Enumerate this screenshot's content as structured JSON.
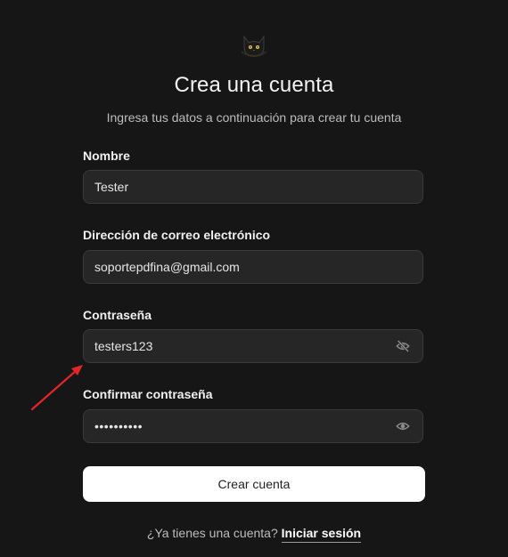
{
  "header": {
    "logo_icon": "cat-logo-icon",
    "title": "Crea una cuenta",
    "subtitle": "Ingresa tus datos a continuación para crear tu cuenta"
  },
  "form": {
    "name": {
      "label": "Nombre",
      "value": "Tester"
    },
    "email": {
      "label": "Dirección de correo electrónico",
      "value": "soportepdfina@gmail.com"
    },
    "password": {
      "label": "Contraseña",
      "value": "testers123",
      "toggle_icon": "eye-off-icon"
    },
    "confirm_password": {
      "label": "Confirmar contraseña",
      "value": "••••••••••",
      "toggle_icon": "eye-icon"
    },
    "submit_label": "Crear cuenta"
  },
  "footer": {
    "prompt": "¿Ya tienes una cuenta?",
    "link": "Iniciar sesión"
  },
  "annotation": {
    "arrow_color": "#e0262b"
  },
  "colors": {
    "background": "#161616",
    "field_bg": "#262626",
    "button_bg": "#ffffff"
  }
}
